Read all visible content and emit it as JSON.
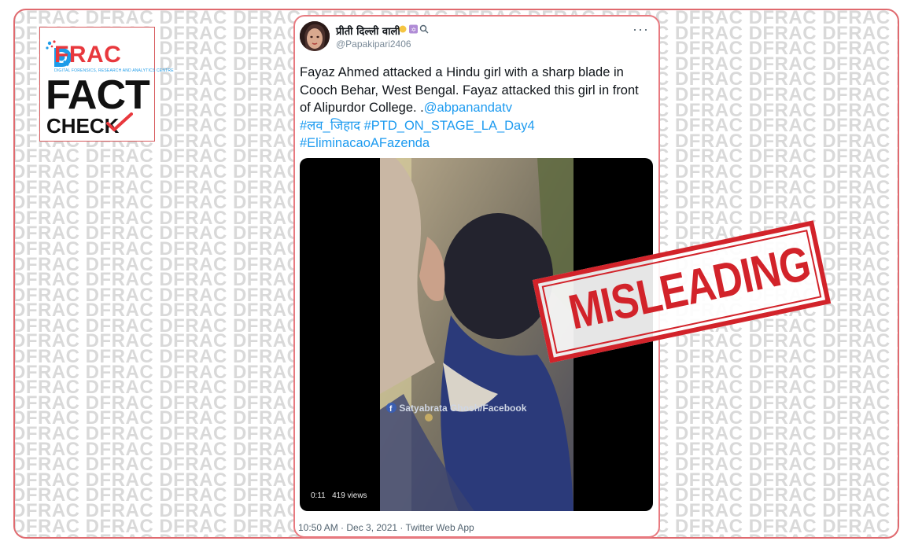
{
  "watermark": {
    "word": "DFRAC"
  },
  "logo": {
    "brand": "FRAC",
    "tagline": "DIGITAL FORENSICS, RESEARCH AND ANALYTICS CENTRE",
    "fact": "FACT",
    "check": "CHECK"
  },
  "tweet": {
    "display_name": "प्रीती दिल्ली वाली",
    "handle": "@Papakipari2406",
    "more_label": "···",
    "text_main": "Fayaz Ahmed attacked a Hindu girl with a sharp blade in Cooch Behar, West Bengal. Fayaz attacked this girl in front of Alipurdor College. .",
    "mention": "@abpanandatv",
    "hashtag1": "#लव_जिहाद",
    "hashtag2": "#PTD_ON_STAGE_LA_Day4",
    "hashtag3": "#EliminacaoAFazenda",
    "video_time": "0:11",
    "video_views": "419 views",
    "video_overlay": "Satyabrata Ghosh/Facebook",
    "footer": "10:50 AM · Dec 3, 2021 · Twitter Web App"
  },
  "stamp": {
    "label": "MISLEADING"
  },
  "colors": {
    "accent": "#e8383d",
    "stamp": "#d2232a",
    "link": "#1d9bf0",
    "frame_border": "#e06a6f"
  }
}
